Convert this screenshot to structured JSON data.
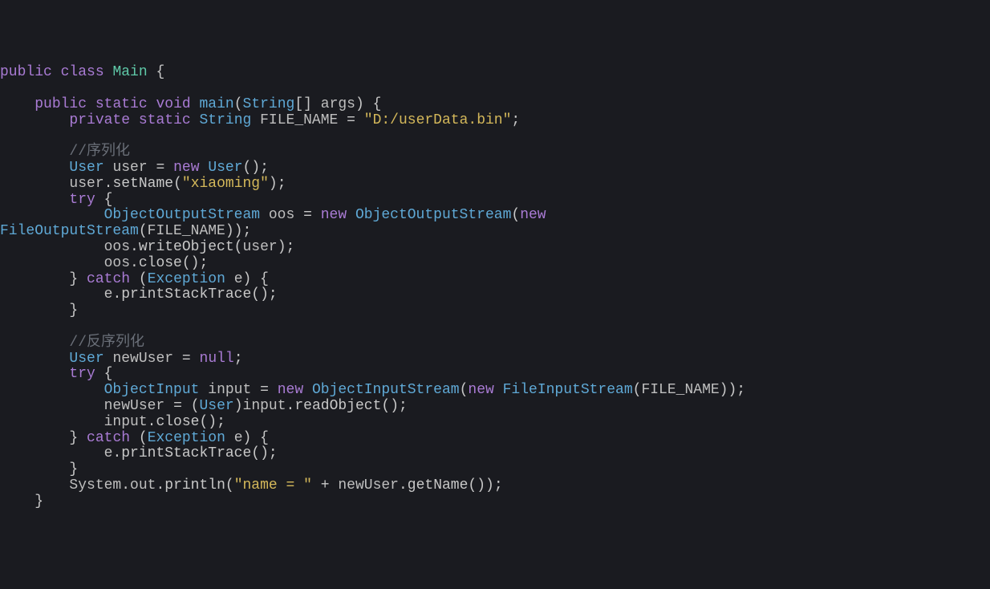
{
  "code": {
    "l0": {
      "kw_public": "public",
      "kw_class": "class",
      "main": "Main",
      "ob": "{"
    },
    "blank1": "",
    "l2": {
      "kw_public": "public",
      "kw_static": "static",
      "kw_void": "void",
      "main_fn": "main",
      "lp": "(",
      "str_arr": "String",
      "brackets": "[]",
      "args": "args",
      "rp": ")",
      "ob": "{"
    },
    "l3": {
      "kw_private": "private",
      "kw_static": "static",
      "str_t": "String",
      "name": "FILE_NAME",
      "eq": "=",
      "val": "\"D:/userData.bin\"",
      "semi": ";"
    },
    "blank2": "",
    "l5": {
      "comment": "//序列化"
    },
    "l6": {
      "type": "User",
      "var": "user",
      "eq": "=",
      "kw_new": "new",
      "ctor": "User",
      "args": "()",
      "semi": ";"
    },
    "l7": {
      "obj": "user",
      "dot": ".",
      "m": "setName",
      "lp": "(",
      "s": "\"xiaoming\"",
      "rp": ")",
      "semi": ";"
    },
    "l8": {
      "kw_try": "try",
      "ob": "{"
    },
    "l9": {
      "type": "ObjectOutputStream",
      "var": "oos",
      "eq": "=",
      "kw_new": "new",
      "ctor": "ObjectOutputStream",
      "lp": "(",
      "kw_new2": "new"
    },
    "l10": {
      "ctor": "FileOutputStream",
      "lp": "(",
      "arg": "FILE_NAME",
      "rp": ")",
      "rp2": ")",
      "semi": ";"
    },
    "l11": {
      "obj": "oos",
      "dot": ".",
      "m": "writeObject",
      "lp": "(",
      "arg": "user",
      "rp": ")",
      "semi": ";"
    },
    "l12": {
      "obj": "oos",
      "dot": ".",
      "m": "close",
      "lp": "(",
      "rp": ")",
      "semi": ";"
    },
    "l13": {
      "cb": "}",
      "kw_catch": "catch",
      "lp": "(",
      "type": "Exception",
      "var": "e",
      "rp": ")",
      "ob": "{"
    },
    "l14": {
      "obj": "e",
      "dot": ".",
      "m": "printStackTrace",
      "lp": "(",
      "rp": ")",
      "semi": ";"
    },
    "l15": {
      "cb": "}"
    },
    "blank3": "",
    "l17": {
      "comment": "//反序列化"
    },
    "l18": {
      "type": "User",
      "var": "newUser",
      "eq": "=",
      "null": "null",
      "semi": ";"
    },
    "l19": {
      "kw_try": "try",
      "ob": "{"
    },
    "l20": {
      "type": "ObjectInput",
      "var": "input",
      "eq": "=",
      "kw_new": "new",
      "ctor": "ObjectInputStream",
      "lp": "(",
      "kw_new2": "new",
      "ctor2": "FileInputStream",
      "lp2": "(",
      "arg": "FILE_NAME",
      "rp2": ")",
      "rp": ")",
      "semi": ";"
    },
    "l21": {
      "obj": "newUser",
      "eq": "=",
      "lp": "(",
      "type": "User",
      "rp": ")",
      "obj2": "input",
      "dot": ".",
      "m": "readObject",
      "lp2": "(",
      "rp2": ")",
      "semi": ";"
    },
    "l22": {
      "obj": "input",
      "dot": ".",
      "m": "close",
      "lp": "(",
      "rp": ")",
      "semi": ";"
    },
    "l23": {
      "cb": "}",
      "kw_catch": "catch",
      "lp": "(",
      "type": "Exception",
      "var": "e",
      "rp": ")",
      "ob": "{"
    },
    "l24": {
      "obj": "e",
      "dot": ".",
      "m": "printStackTrace",
      "lp": "(",
      "rp": ")",
      "semi": ";"
    },
    "l25": {
      "cb": "}"
    },
    "l26": {
      "sys": "System",
      "dot": ".",
      "out": "out",
      "dot2": ".",
      "m": "println",
      "lp": "(",
      "s": "\"name = \"",
      "plus": "+",
      "obj": "newUser",
      "dot3": ".",
      "m2": "getName",
      "lp2": "(",
      "rp2": ")",
      "rp": ")",
      "semi": ";"
    },
    "l27": {
      "cb": "}"
    }
  }
}
